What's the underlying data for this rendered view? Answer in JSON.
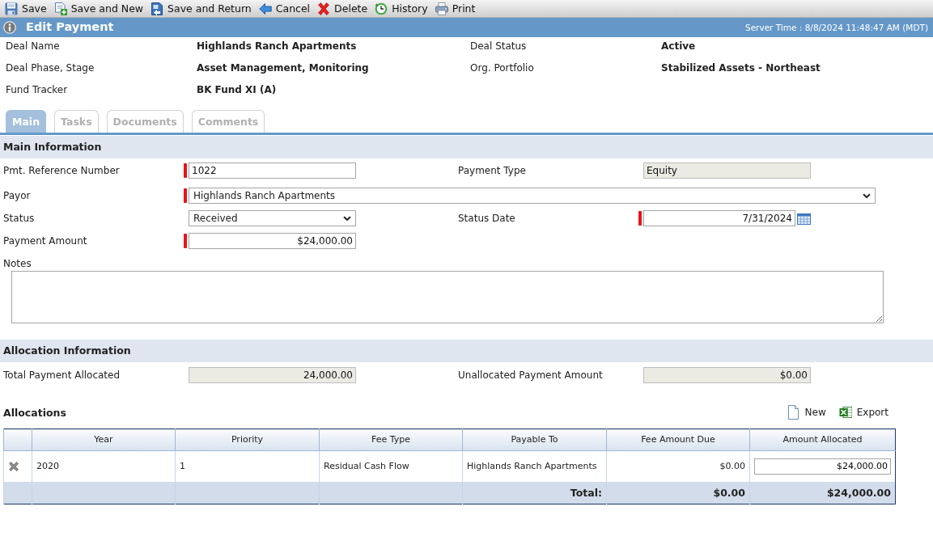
{
  "toolbar": [
    {
      "label": "Save"
    },
    {
      "label": "Save and New"
    },
    {
      "label": "Save and Return"
    },
    {
      "label": "Cancel"
    },
    {
      "label": "Delete"
    },
    {
      "label": "History"
    },
    {
      "label": "Print"
    }
  ],
  "header": {
    "title": "Edit Payment",
    "server_time": "Server Time : 8/8/2024 11:48:47 AM (MDT)"
  },
  "deal_info": [
    [
      {
        "label": "Deal Name",
        "value": "Highlands Ranch Apartments"
      },
      {
        "label": "Deal Status",
        "value": "Active"
      }
    ],
    [
      {
        "label": "Deal Phase, Stage",
        "value": "Asset Management, Monitoring"
      },
      {
        "label": "Org. Portfolio",
        "value": "Stabilized Assets - Northeast"
      }
    ],
    [
      {
        "label": "Fund Tracker",
        "value": "BK Fund XI (A)"
      }
    ]
  ],
  "tabs": [
    {
      "label": "Main",
      "selected": true
    },
    {
      "label": "Tasks",
      "selected": false
    },
    {
      "label": "Documents",
      "selected": false
    },
    {
      "label": "Comments",
      "selected": false
    }
  ],
  "main_information": {
    "title": "Main Information",
    "rows": [
      [
        {
          "label": "Pmt. Reference Number",
          "kind": "text",
          "value": "1022",
          "required": true,
          "disabled": false
        },
        {
          "label": "Payment Type",
          "kind": "text",
          "value": "Equity",
          "required": false,
          "disabled": true
        }
      ],
      [
        {
          "label": "Payor",
          "kind": "select",
          "value": "Highlands Ranch Apartments",
          "required": true,
          "disabled": false
        }
      ],
      [
        {
          "label": "Status",
          "kind": "select",
          "value": "Received",
          "required": false,
          "disabled": false
        },
        {
          "label": "Status Date",
          "kind": "date",
          "value": "7/31/2024",
          "required": true,
          "disabled": false
        }
      ],
      [
        {
          "label": "Payment Amount",
          "kind": "amount",
          "value": "$24,000.00",
          "required": true,
          "disabled": false
        }
      ]
    ],
    "notes": {
      "label": "Notes"
    }
  },
  "allocation_information": {
    "title": "Allocation Information",
    "rows": [
      [
        {
          "label": "Total Payment Allocated",
          "kind": "amount",
          "value": "24,000.00",
          "disabled": true
        },
        {
          "label": "Unallocated Payment Amount",
          "kind": "amount",
          "value": "$0.00",
          "disabled": true
        }
      ]
    ]
  },
  "allocations": {
    "title": "Allocations",
    "actions": [
      {
        "label": "New"
      },
      {
        "label": "Export"
      }
    ],
    "table": {
      "columns": [
        "Year",
        "Priority",
        "Fee Type",
        "Payable To",
        "Fee Amount Due",
        "Amount Allocated"
      ],
      "rows": [
        {
          "cells": [
            "2020",
            "1",
            "Residual Cash Flow",
            "Highlands Ranch Apartments",
            "$0.00"
          ],
          "amount_allocated": "$24,000.00"
        }
      ],
      "total": {
        "label": "Total:",
        "fee_amount_due": "$0.00",
        "amount_allocated": "$24,000.00"
      }
    }
  }
}
